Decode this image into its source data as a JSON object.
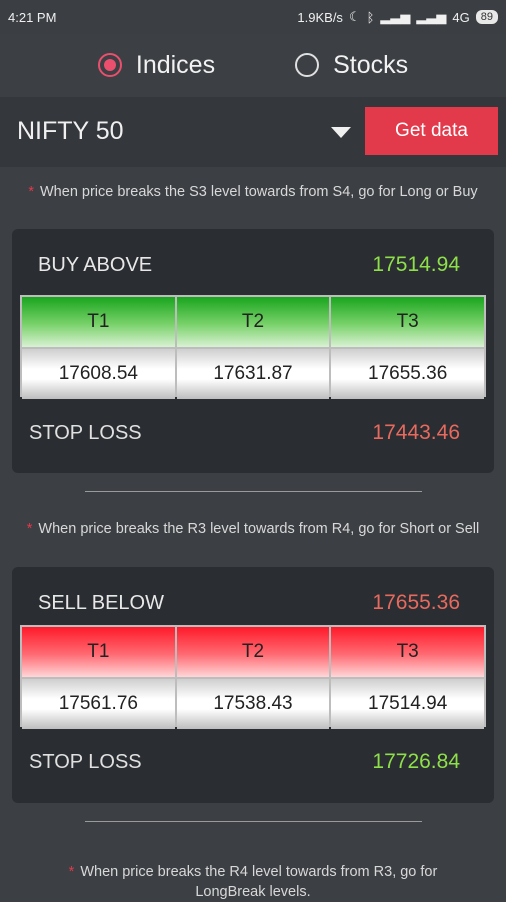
{
  "status": {
    "time": "4:21 PM",
    "speed": "1.9KB/s",
    "network": "4G",
    "battery": "89"
  },
  "mode": {
    "indices": "Indices",
    "stocks": "Stocks"
  },
  "selector": {
    "index": "NIFTY 50",
    "get_data": "Get data"
  },
  "buy": {
    "note": "When price breaks the S3 level towards from S4, go for Long or Buy",
    "label": "BUY ABOVE",
    "value": "17514.94",
    "targets": [
      {
        "name": "T1",
        "value": "17608.54"
      },
      {
        "name": "T2",
        "value": "17631.87"
      },
      {
        "name": "T3",
        "value": "17655.36"
      }
    ],
    "stop_label": "STOP LOSS",
    "stop_value": "17443.46"
  },
  "sell": {
    "note": "When price breaks the R3 level towards from R4, go for Short or Sell",
    "label": "SELL BELOW",
    "value": "17655.36",
    "targets": [
      {
        "name": "T1",
        "value": "17561.76"
      },
      {
        "name": "T2",
        "value": "17538.43"
      },
      {
        "name": "T3",
        "value": "17514.94"
      }
    ],
    "stop_label": "STOP LOSS",
    "stop_value": "17726.84"
  },
  "longbreak_note": "When price breaks the R4 level towards from R3, go for LongBreak levels.",
  "colors": {
    "accent": "#e23a4b",
    "green": "#8ee04a",
    "red": "#e86a5f"
  }
}
